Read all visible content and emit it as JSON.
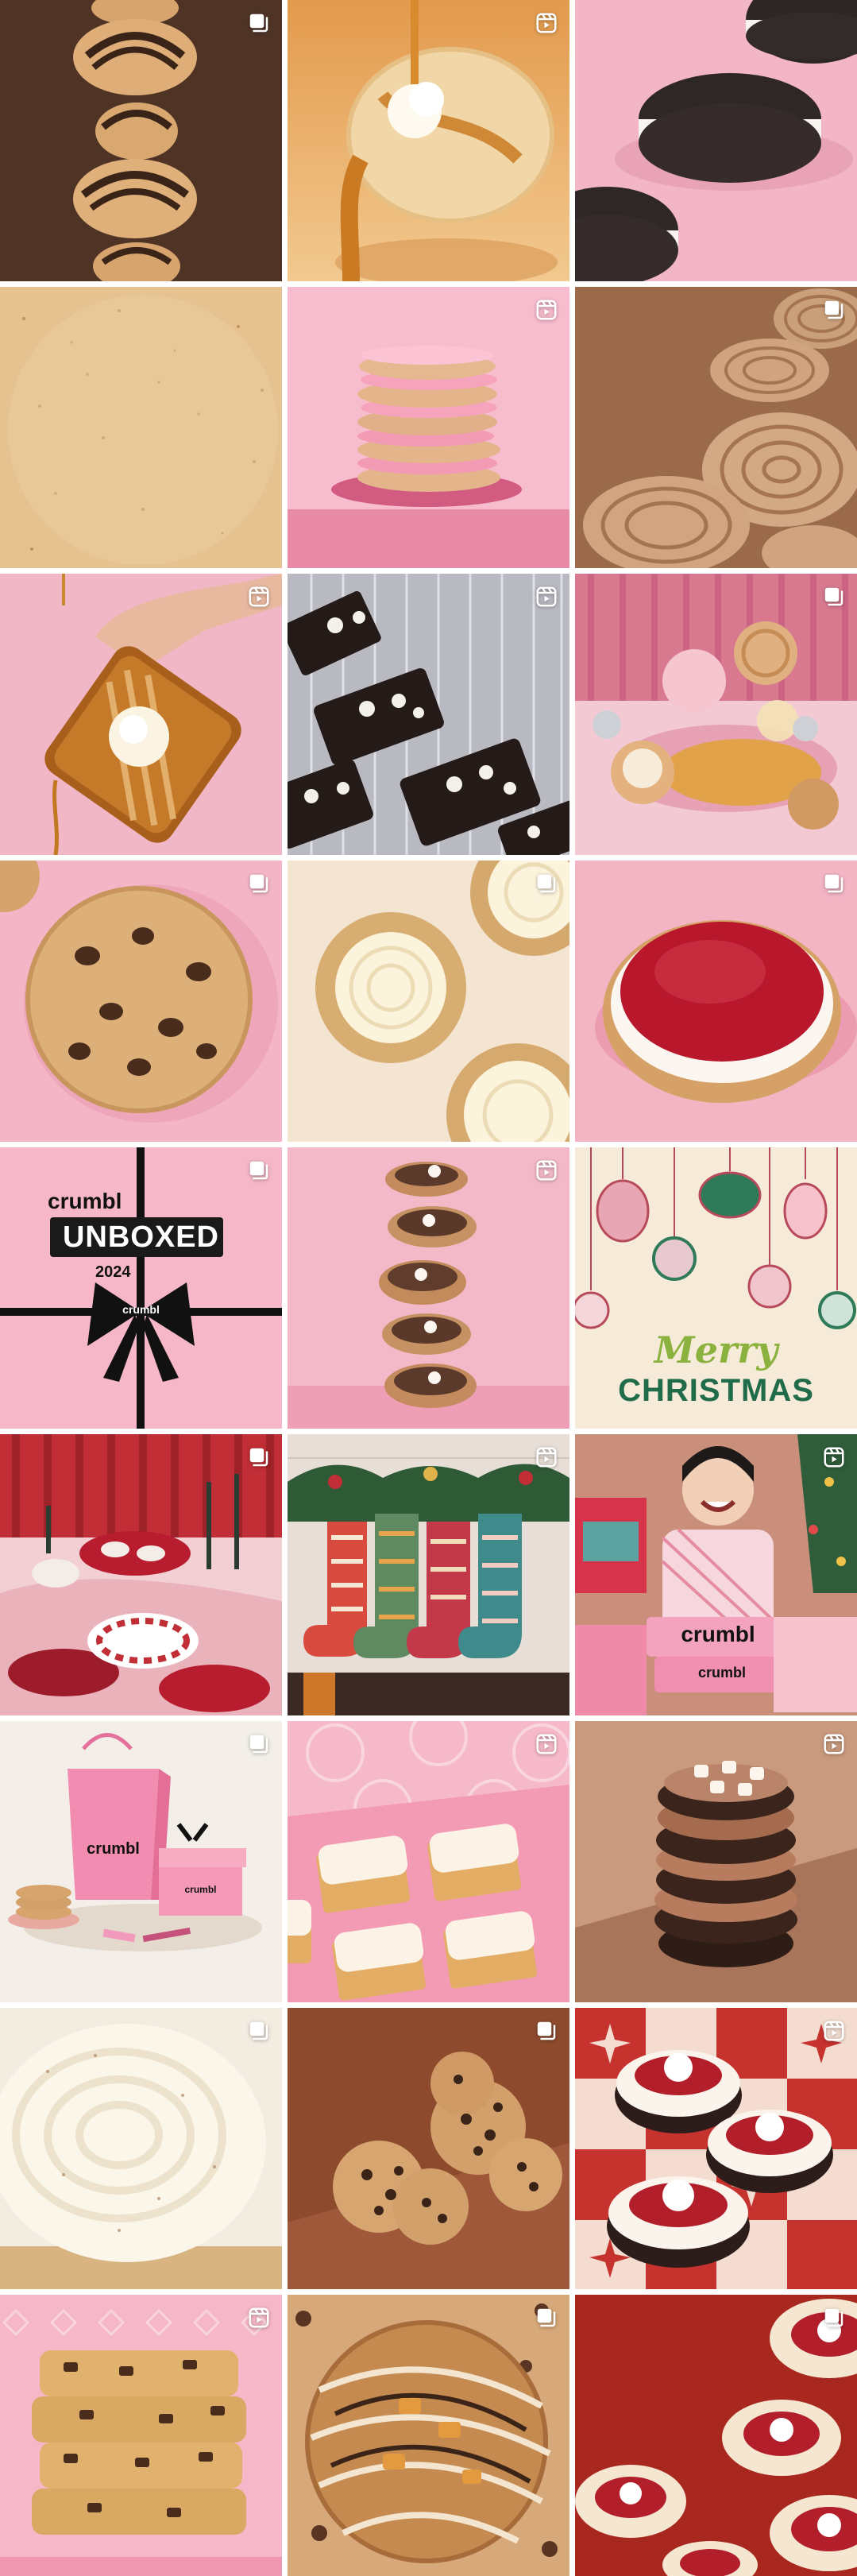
{
  "feed": {
    "columns": 3,
    "posts": [
      {
        "id": 1,
        "badge": "carousel",
        "subject": "chocolate drizzle cookies stack",
        "bg": "#5a3b2b"
      },
      {
        "id": 2,
        "badge": "reel",
        "subject": "caramel drizzle cookie",
        "bg": "#e8a55a"
      },
      {
        "id": 3,
        "badge": "none",
        "subject": "chocolate sandwich cookies",
        "bg": "#f2b6c6"
      },
      {
        "id": 4,
        "badge": "none",
        "subject": "sugar cookie texture",
        "bg": "#e5c28f"
      },
      {
        "id": 5,
        "badge": "reel",
        "subject": "pink sugar cookie stack",
        "bg": "#f7bccd"
      },
      {
        "id": 6,
        "badge": "carousel",
        "subject": "snickerdoodle swirl cookies",
        "bg": "#9b6a4b"
      },
      {
        "id": 7,
        "badge": "reel",
        "subject": "caramel toast with cream",
        "bg": "#f2b7c6"
      },
      {
        "id": 8,
        "badge": "reel",
        "subject": "cookies and cream brownies",
        "bg": "#b9b9c2"
      },
      {
        "id": 9,
        "badge": "carousel",
        "subject": "holiday party cookies",
        "bg": "#e6a2b2"
      },
      {
        "id": 10,
        "badge": "carousel",
        "subject": "chocolate chip cookie",
        "bg": "#f4b6c7"
      },
      {
        "id": 11,
        "badge": "carousel",
        "subject": "frosted swirl sugar cookies",
        "bg": "#f3e5d2"
      },
      {
        "id": 12,
        "badge": "carousel",
        "subject": "raspberry cheesecake",
        "bg": "#f3b5c4"
      },
      {
        "id": 13,
        "badge": "carousel",
        "subject": "crumbl unboxed 2024",
        "bg": "#f6b8c8",
        "brand": "crumbl",
        "headline": "UNBOXED",
        "year": "2024",
        "ribbon": "crumbl"
      },
      {
        "id": 14,
        "badge": "reel",
        "subject": "marshmallow cookie tower",
        "bg": "#f3b9c9"
      },
      {
        "id": 15,
        "badge": "none",
        "subject": "merry christmas ornaments",
        "bg": "#f6ead8",
        "line1": "Merry",
        "line2": "CHRISTMAS"
      },
      {
        "id": 16,
        "badge": "carousel",
        "subject": "peppermint party table",
        "bg": "#c22e36"
      },
      {
        "id": 17,
        "badge": "reel",
        "subject": "christmas stockings",
        "bg": "#7a2a25"
      },
      {
        "id": 18,
        "badge": "reel",
        "subject": "smiling kid with crumbl boxes",
        "bg": "#c98f7a",
        "box_label": "crumbl",
        "box_label2": "crumbl"
      },
      {
        "id": 19,
        "badge": "carousel",
        "subject": "pink crumbl bag and gifts",
        "bg": "#f3efe8",
        "bag_label": "crumbl",
        "box_label": "crumbl"
      },
      {
        "id": 20,
        "badge": "reel",
        "subject": "frosted bars on pink",
        "bg": "#f6b9c9"
      },
      {
        "id": 21,
        "badge": "reel",
        "subject": "hot cocoa marshmallow cookies",
        "bg": "#c99a7d"
      },
      {
        "id": 22,
        "badge": "carousel",
        "subject": "cream frosting swirl",
        "bg": "#f3ece1"
      },
      {
        "id": 23,
        "badge": "carousel",
        "subject": "chocolate chip cookies brown",
        "bg": "#8d4a2d"
      },
      {
        "id": 24,
        "badge": "reel",
        "subject": "cherry cheesecake cookies",
        "bg": "#c6322e"
      },
      {
        "id": 25,
        "badge": "reel",
        "subject": "chocolate chunk bars stack",
        "bg": "#f6b8c8"
      },
      {
        "id": 26,
        "badge": "carousel",
        "subject": "toffee drizzle cookie",
        "bg": "#d7a879"
      },
      {
        "id": 27,
        "badge": "carousel",
        "subject": "raspberry cream cookies",
        "bg": "#a8271f"
      }
    ]
  },
  "colors": {
    "pink": "#f4b7c7",
    "brown": "#5a3b2b",
    "cookie": "#d9a76a",
    "chocolate": "#3a2418",
    "cream": "#fbf3e4",
    "red": "#b8262a",
    "green": "#1f6b4a"
  }
}
